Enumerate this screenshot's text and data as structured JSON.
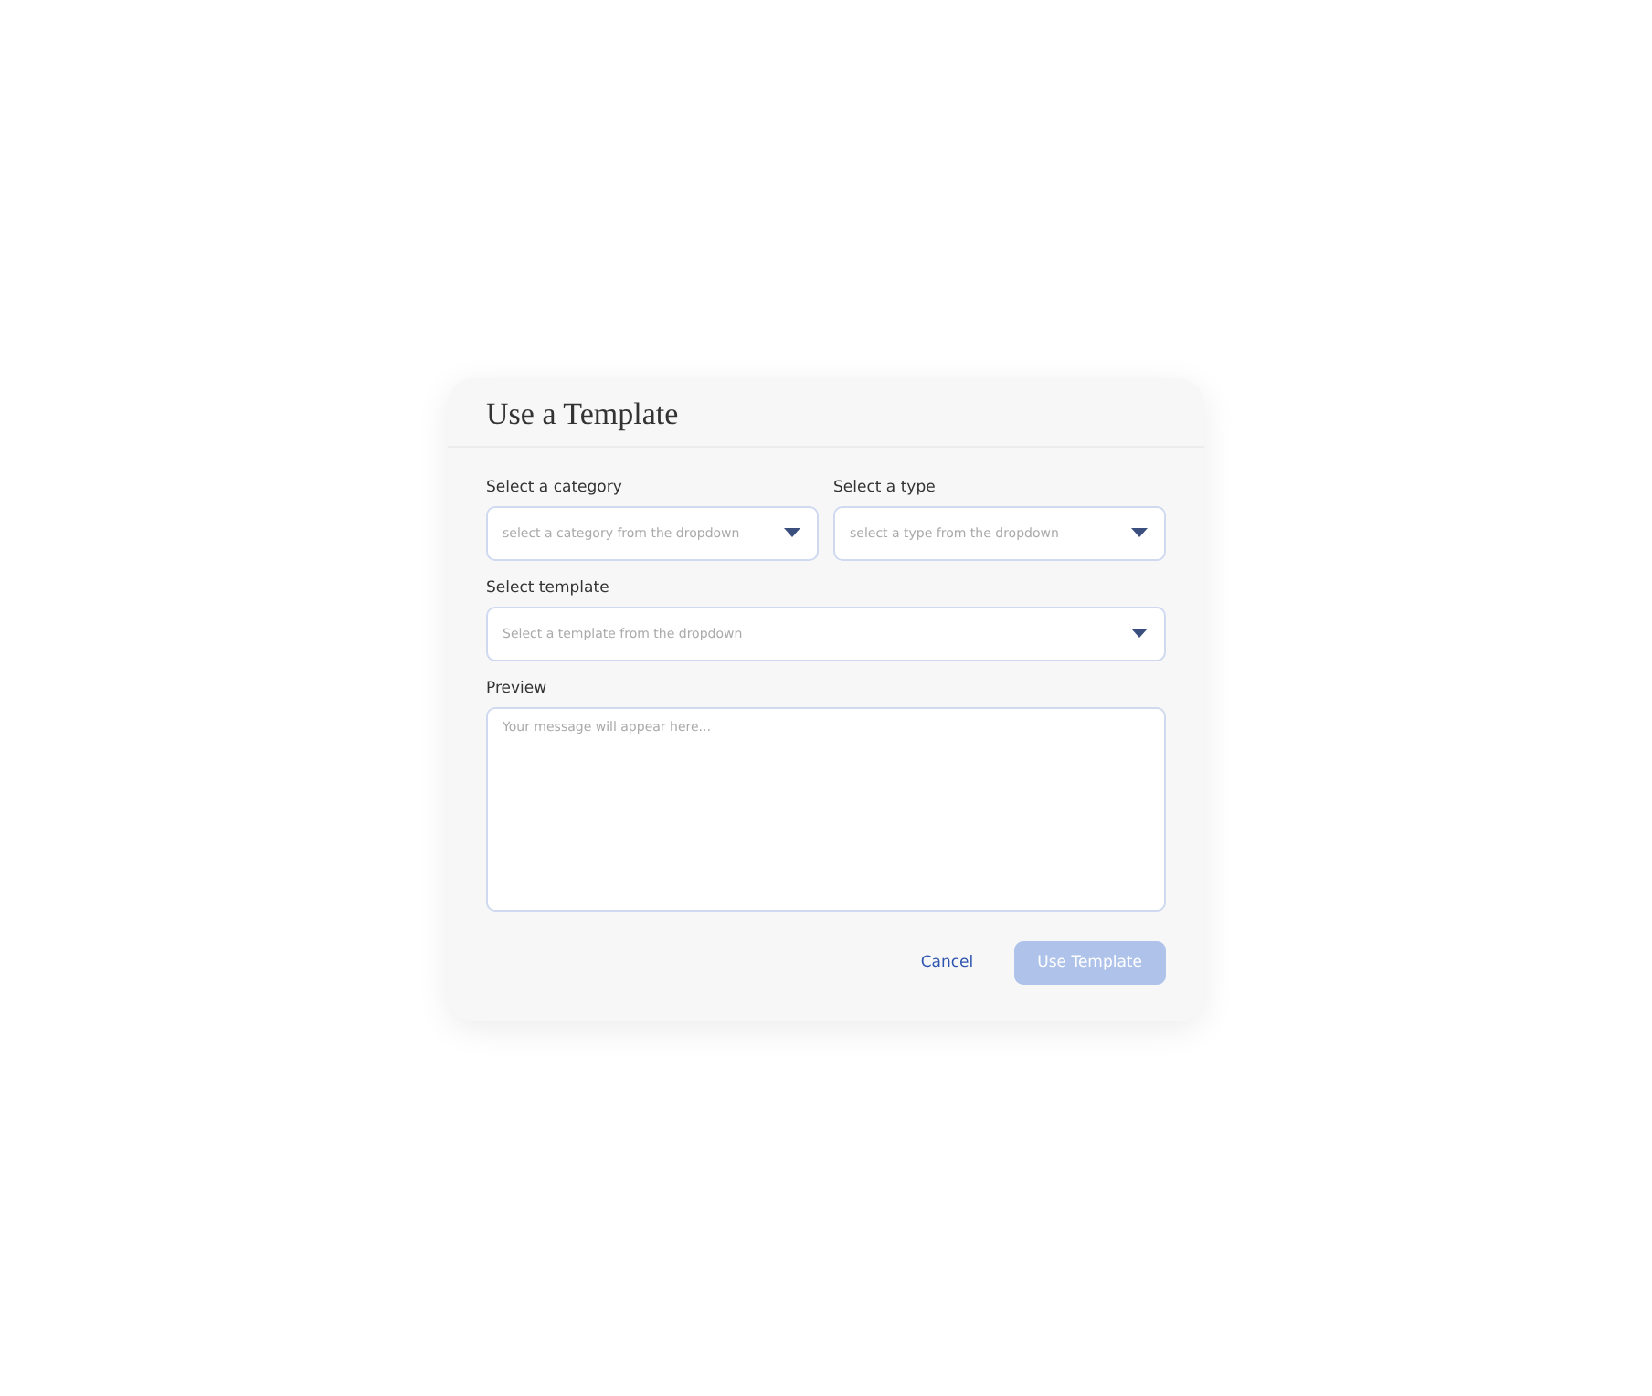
{
  "dialog": {
    "title": "Use a Template"
  },
  "dropdowns": [
    {
      "label": "Select a category",
      "placeholder": "select a category from the dropdown"
    },
    {
      "label": "Select a type",
      "placeholder": "select a type from the dropdown"
    },
    {
      "label": "Select template",
      "placeholder": "Select a template from the dropdown"
    }
  ],
  "preview": {
    "label": "Preview",
    "placeholder": "Your message will appear here..."
  },
  "buttons": [
    {
      "label": "Cancel",
      "kind": "link",
      "disabled": false
    },
    {
      "label": "Use Template",
      "kind": "primary",
      "disabled": true
    }
  ]
}
